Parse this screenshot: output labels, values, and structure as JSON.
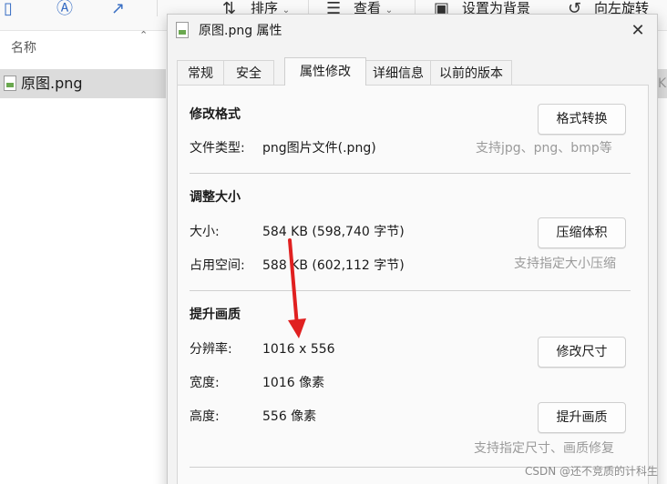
{
  "explorer": {
    "toolbar": {
      "sort_label": "排序",
      "view_label": "查看",
      "set_background_label": "设置为背景",
      "rotate_left_label": "向左旋转"
    },
    "column_header": "名称",
    "file": {
      "name": "原图.png"
    },
    "right_edge_text": "KE"
  },
  "dialog": {
    "title": "原图.png 属性",
    "close_glyph": "✕",
    "tabs": [
      "常规",
      "安全",
      "属性修改",
      "详细信息",
      "以前的版本"
    ],
    "active_tab": "属性修改",
    "sections": {
      "format": {
        "title": "修改格式",
        "file_type_label": "文件类型:",
        "file_type_value": "png图片文件(.png)",
        "button": "格式转换",
        "hint": "支持jpg、png、bmp等"
      },
      "size": {
        "title": "调整大小",
        "size_label": "大小:",
        "size_value": "584 KB (598,740 字节)",
        "disk_label": "占用空间:",
        "disk_value": "588 KB (602,112 字节)",
        "button": "压缩体积",
        "hint": "支持指定大小压缩"
      },
      "quality": {
        "title": "提升画质",
        "resolution_label": "分辨率:",
        "resolution_value": "1016 x 556",
        "width_label": "宽度:",
        "width_value": "1016 像素",
        "height_label": "高度:",
        "height_value": "556 像素",
        "resize_button": "修改尺寸",
        "enhance_button": "提升画质",
        "hint": "支持指定尺寸、画质修复"
      }
    }
  },
  "watermark": "CSDN @还不竞质的计科生",
  "colors": {
    "arrow": "#e02020",
    "hint_text": "#9a9a9a",
    "selected_row": "#dcdcdc"
  }
}
